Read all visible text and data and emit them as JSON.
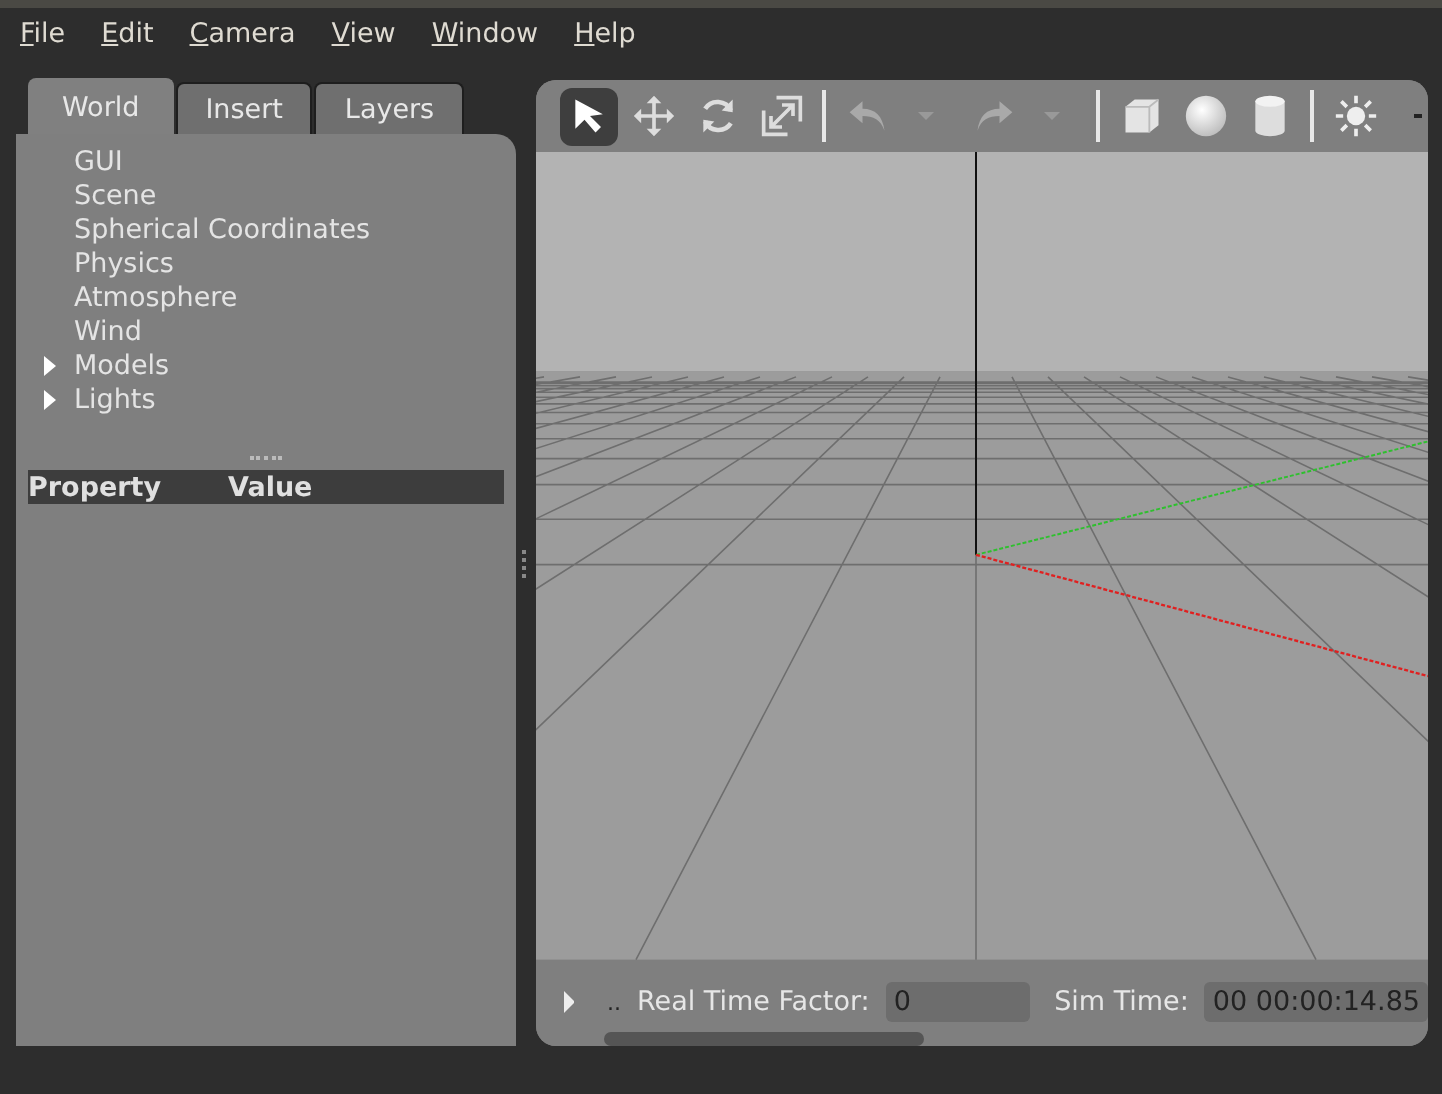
{
  "menu": [
    "File",
    "Edit",
    "Camera",
    "View",
    "Window",
    "Help"
  ],
  "tabs": [
    {
      "label": "World",
      "selected": true
    },
    {
      "label": "Insert",
      "selected": false
    },
    {
      "label": "Layers",
      "selected": false
    }
  ],
  "tree": [
    {
      "label": "GUI",
      "kind": "leaf"
    },
    {
      "label": "Scene",
      "kind": "leaf"
    },
    {
      "label": "Spherical Coordinates",
      "kind": "leaf"
    },
    {
      "label": "Physics",
      "kind": "leaf"
    },
    {
      "label": "Atmosphere",
      "kind": "leaf"
    },
    {
      "label": "Wind",
      "kind": "leaf"
    },
    {
      "label": "Models",
      "kind": "group",
      "expanded": false
    },
    {
      "label": "Lights",
      "kind": "group",
      "expanded": false
    }
  ],
  "property_table": {
    "columns": [
      "Property",
      "Value"
    ]
  },
  "toolbar": {
    "tools": [
      {
        "kind": "select",
        "selected": true
      },
      {
        "kind": "translate",
        "selected": false
      },
      {
        "kind": "rotate",
        "selected": false
      },
      {
        "kind": "scale",
        "selected": false
      }
    ],
    "history": [
      {
        "kind": "undo",
        "disabled": true
      },
      {
        "kind": "redo",
        "disabled": true
      }
    ],
    "shapes": [
      {
        "kind": "box"
      },
      {
        "kind": "sphere"
      },
      {
        "kind": "cylinder"
      }
    ]
  },
  "status_bar": {
    "more": "..",
    "real_time_factor_label": "Real Time Factor:",
    "real_time_factor": "0",
    "sim_time_label": "Sim Time:",
    "sim_time": "00 00:00:14.85"
  }
}
